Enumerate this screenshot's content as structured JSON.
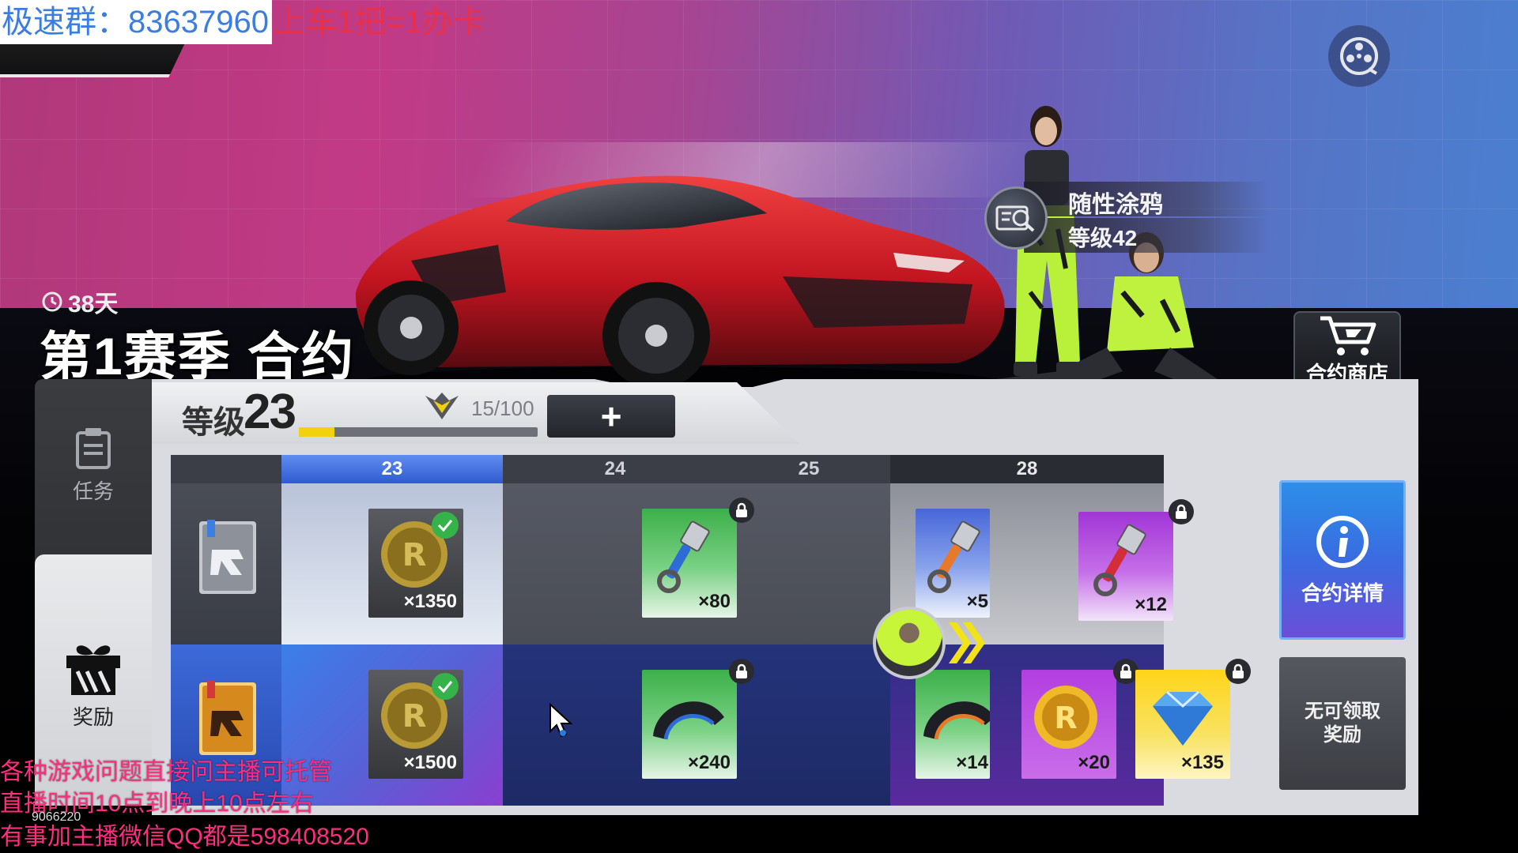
{
  "watermark": {
    "group_label": "极速群：83637960",
    "group_extra": "上车1把=1办卡",
    "bottom_lines": [
      "各种游戏问题直接问主播可托管",
      "直播时间10点到晚上10点左右",
      "有事加主播微信QQ都是598408520"
    ],
    "small_id": "9066220"
  },
  "player": {
    "name": "随性涂鸦",
    "level_text": "等级42"
  },
  "season": {
    "days_left": "38天",
    "title": "第1赛季 合约"
  },
  "shop": {
    "label": "合约商店"
  },
  "menu": {
    "tasks_label": "任务",
    "rewards_label": "奖励"
  },
  "level": {
    "label": "等级",
    "value": "23",
    "xp_text": "15/100",
    "xp_fraction": 0.15,
    "plus_label": "+"
  },
  "columns": [
    {
      "level": "23",
      "state": "active"
    },
    {
      "level": "24",
      "state": "normal"
    },
    {
      "level": "25",
      "state": "normal"
    },
    {
      "level": "28",
      "state": "highlight"
    }
  ],
  "rewards": {
    "free_23": {
      "qty": "×1350",
      "claimed": true
    },
    "premium_23": {
      "qty": "×1500",
      "claimed": true
    },
    "free_24": {
      "qty": "×80",
      "locked": true
    },
    "premium_24": {
      "qty": "×240",
      "locked": true
    },
    "free_25": {
      "qty": "×5"
    },
    "premium_25": {
      "qty": "×14"
    },
    "free_28": {
      "qty": "×12",
      "locked": true
    },
    "premium_28a": {
      "qty": "×20",
      "locked": true
    },
    "premium_28b": {
      "qty": "×135",
      "locked": true
    }
  },
  "buttons": {
    "detail_label": "合约详情",
    "claim_label": "无可领取奖励"
  },
  "colors": {
    "accent_blue": "#2f5bd0",
    "xp_yellow": "#f2d20f",
    "lock_dark": "#2a2b30",
    "check_green": "#35b34a"
  }
}
